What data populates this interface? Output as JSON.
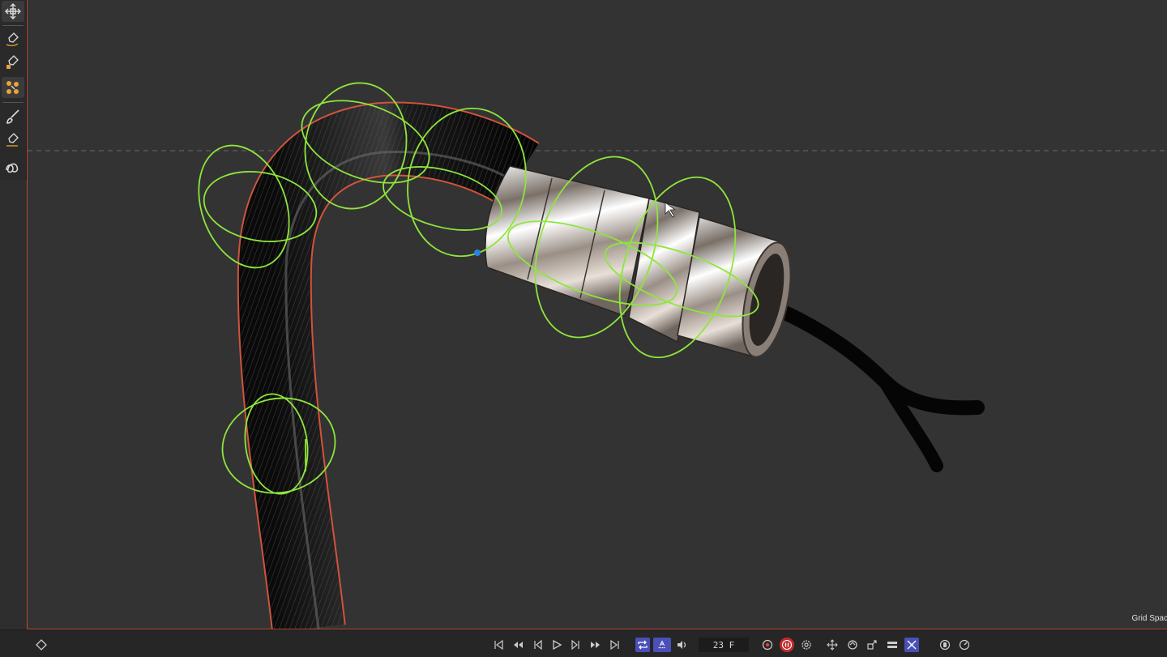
{
  "viewport": {
    "grid_spacing_label": "Grid Spac"
  },
  "toolbar": {
    "tools": [
      {
        "name": "transform-icon"
      },
      {
        "name": "pen-curve-icon"
      },
      {
        "name": "pen-point-icon"
      },
      {
        "name": "pen-multi-icon"
      },
      {
        "name": "brush-icon"
      },
      {
        "name": "pen-icon"
      },
      {
        "name": "spring-icon"
      }
    ]
  },
  "transport": {
    "frame_value": "23 F",
    "buttons": [
      "go-to-start-icon",
      "previous-key-icon",
      "step-back-icon",
      "play-icon",
      "step-forward-icon",
      "next-key-icon",
      "go-to-end-icon",
      "loop-icon",
      "auto-key-icon",
      "audio-icon",
      "record-icon",
      "pause-record-icon",
      "settings-icon",
      "move-key-icon",
      "rotate-key-icon",
      "scale-key-icon",
      "layers-icon",
      "magnet-icon",
      "capture-icon",
      "speed-icon"
    ]
  },
  "colors": {
    "background": "#333333",
    "accent_blue": "#4b4fb8",
    "record_red": "#c42b2b",
    "controller_green": "#8ee63c",
    "selection_outline": "#d0543c"
  }
}
